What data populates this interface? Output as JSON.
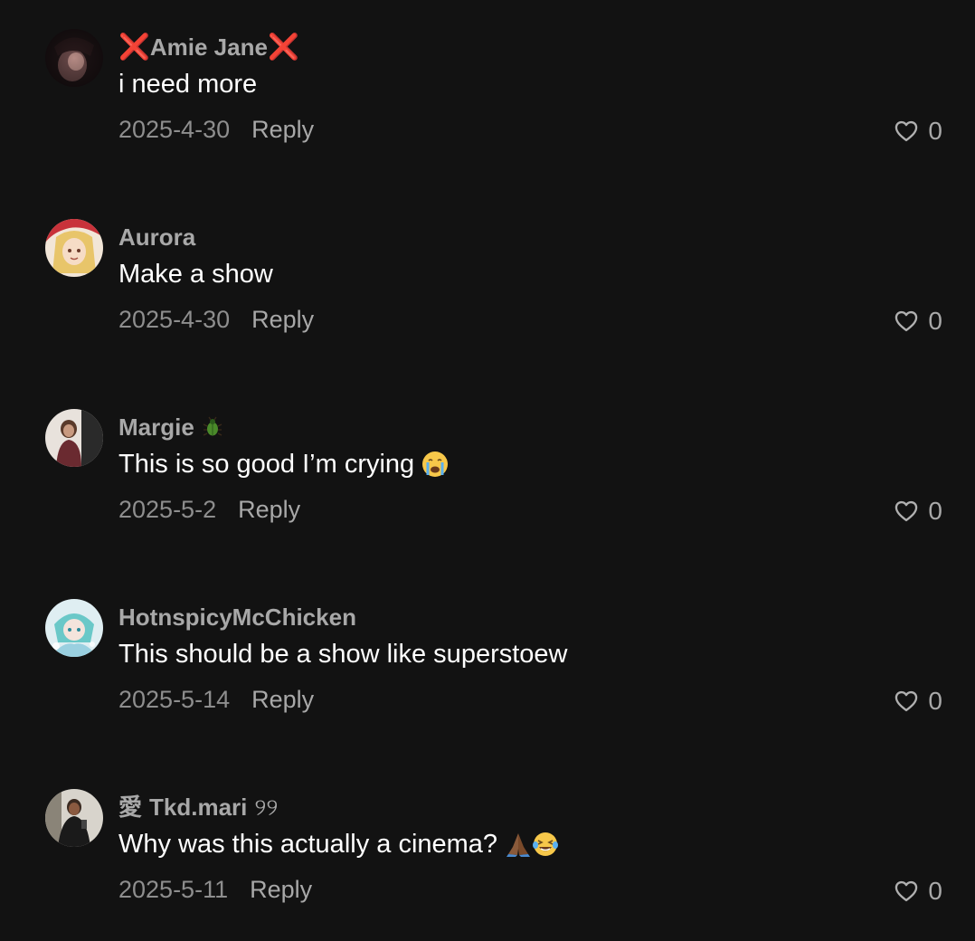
{
  "comments": [
    {
      "username": "Amie Jane",
      "username_decoration": "❌",
      "text": "i need more",
      "date": "2025-4-30",
      "reply_label": "Reply",
      "likes": "0"
    },
    {
      "username": "Aurora",
      "text": "Make a show",
      "date": "2025-4-30",
      "reply_label": "Reply",
      "likes": "0"
    },
    {
      "username": "Margie",
      "username_emoji": "beetle-emoji",
      "text": "This is so good I’m crying",
      "text_emoji": "crying-face-emoji",
      "date": "2025-5-2",
      "reply_label": "Reply",
      "likes": "0"
    },
    {
      "username": "HotnspicyMcChicken",
      "text": "This should be a show like superstoew",
      "date": "2025-5-14",
      "reply_label": "Reply",
      "likes": "0"
    },
    {
      "username_prefix": "愛",
      "username": "Tkd.mari",
      "username_suffix": "୨୨",
      "text": "Why was this actually a cinema?",
      "text_emojis": [
        "folded-hands-emoji",
        "laughing-tears-emoji"
      ],
      "date": "2025-5-11",
      "reply_label": "Reply",
      "likes": "0"
    }
  ],
  "colors": {
    "background": "#121212",
    "username": "#a8a8a8",
    "text": "#ffffff",
    "meta": "#8e8e8e",
    "x_mark": "#d0342c"
  },
  "icons": {
    "like": "heart-outline-icon"
  }
}
